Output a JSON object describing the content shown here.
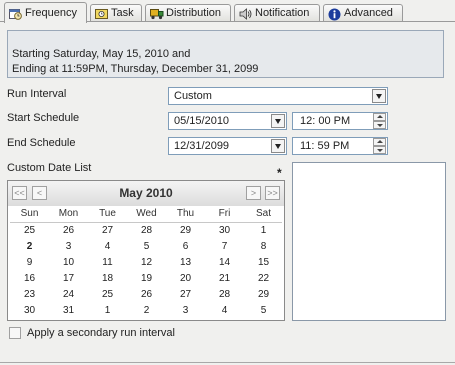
{
  "tabs": [
    {
      "label": "Frequency",
      "icon": "calendar-clock-icon",
      "active": true
    },
    {
      "label": "Task",
      "icon": "task-icon",
      "active": false
    },
    {
      "label": "Distribution",
      "icon": "distribution-truck-icon",
      "active": false
    },
    {
      "label": "Notification",
      "icon": "speaker-icon",
      "active": false
    },
    {
      "label": "Advanced",
      "icon": "info-icon",
      "active": false
    }
  ],
  "summary": {
    "line1": "Starting Saturday, May 15, 2010 and",
    "line2": "Ending at 11:59PM, Thursday, December 31, 2099"
  },
  "run_interval": {
    "label": "Run Interval",
    "value": "Custom"
  },
  "start_schedule": {
    "label": "Start Schedule",
    "date": "05/15/2010",
    "time": "12: 00  PM"
  },
  "end_schedule": {
    "label": "End Schedule",
    "date": "12/31/2099",
    "time": "11: 59  PM"
  },
  "custom_date_list": {
    "label": "Custom Date List",
    "required_marker": "*"
  },
  "calendar": {
    "title": "May 2010",
    "nav": {
      "prev_year": "<<",
      "prev_month": "<",
      "next_month": ">",
      "next_year": ">>"
    },
    "weekdays": [
      "Sun",
      "Mon",
      "Tue",
      "Wed",
      "Thu",
      "Fri",
      "Sat"
    ],
    "weeks": [
      [
        "25",
        "26",
        "27",
        "28",
        "29",
        "30",
        "1"
      ],
      [
        "2",
        "3",
        "4",
        "5",
        "6",
        "7",
        "8"
      ],
      [
        "9",
        "10",
        "11",
        "12",
        "13",
        "14",
        "15"
      ],
      [
        "16",
        "17",
        "18",
        "19",
        "20",
        "21",
        "22"
      ],
      [
        "23",
        "24",
        "25",
        "26",
        "27",
        "28",
        "29"
      ],
      [
        "30",
        "31",
        "1",
        "2",
        "3",
        "4",
        "5"
      ]
    ],
    "highlighted_day": "2"
  },
  "secondary_interval": {
    "label": "Apply a secondary run interval",
    "checked": false
  },
  "colors": {
    "panel_bg": "#f0f0ee",
    "info_bg": "#e6e9ec",
    "field_border": "#7f9db9"
  }
}
